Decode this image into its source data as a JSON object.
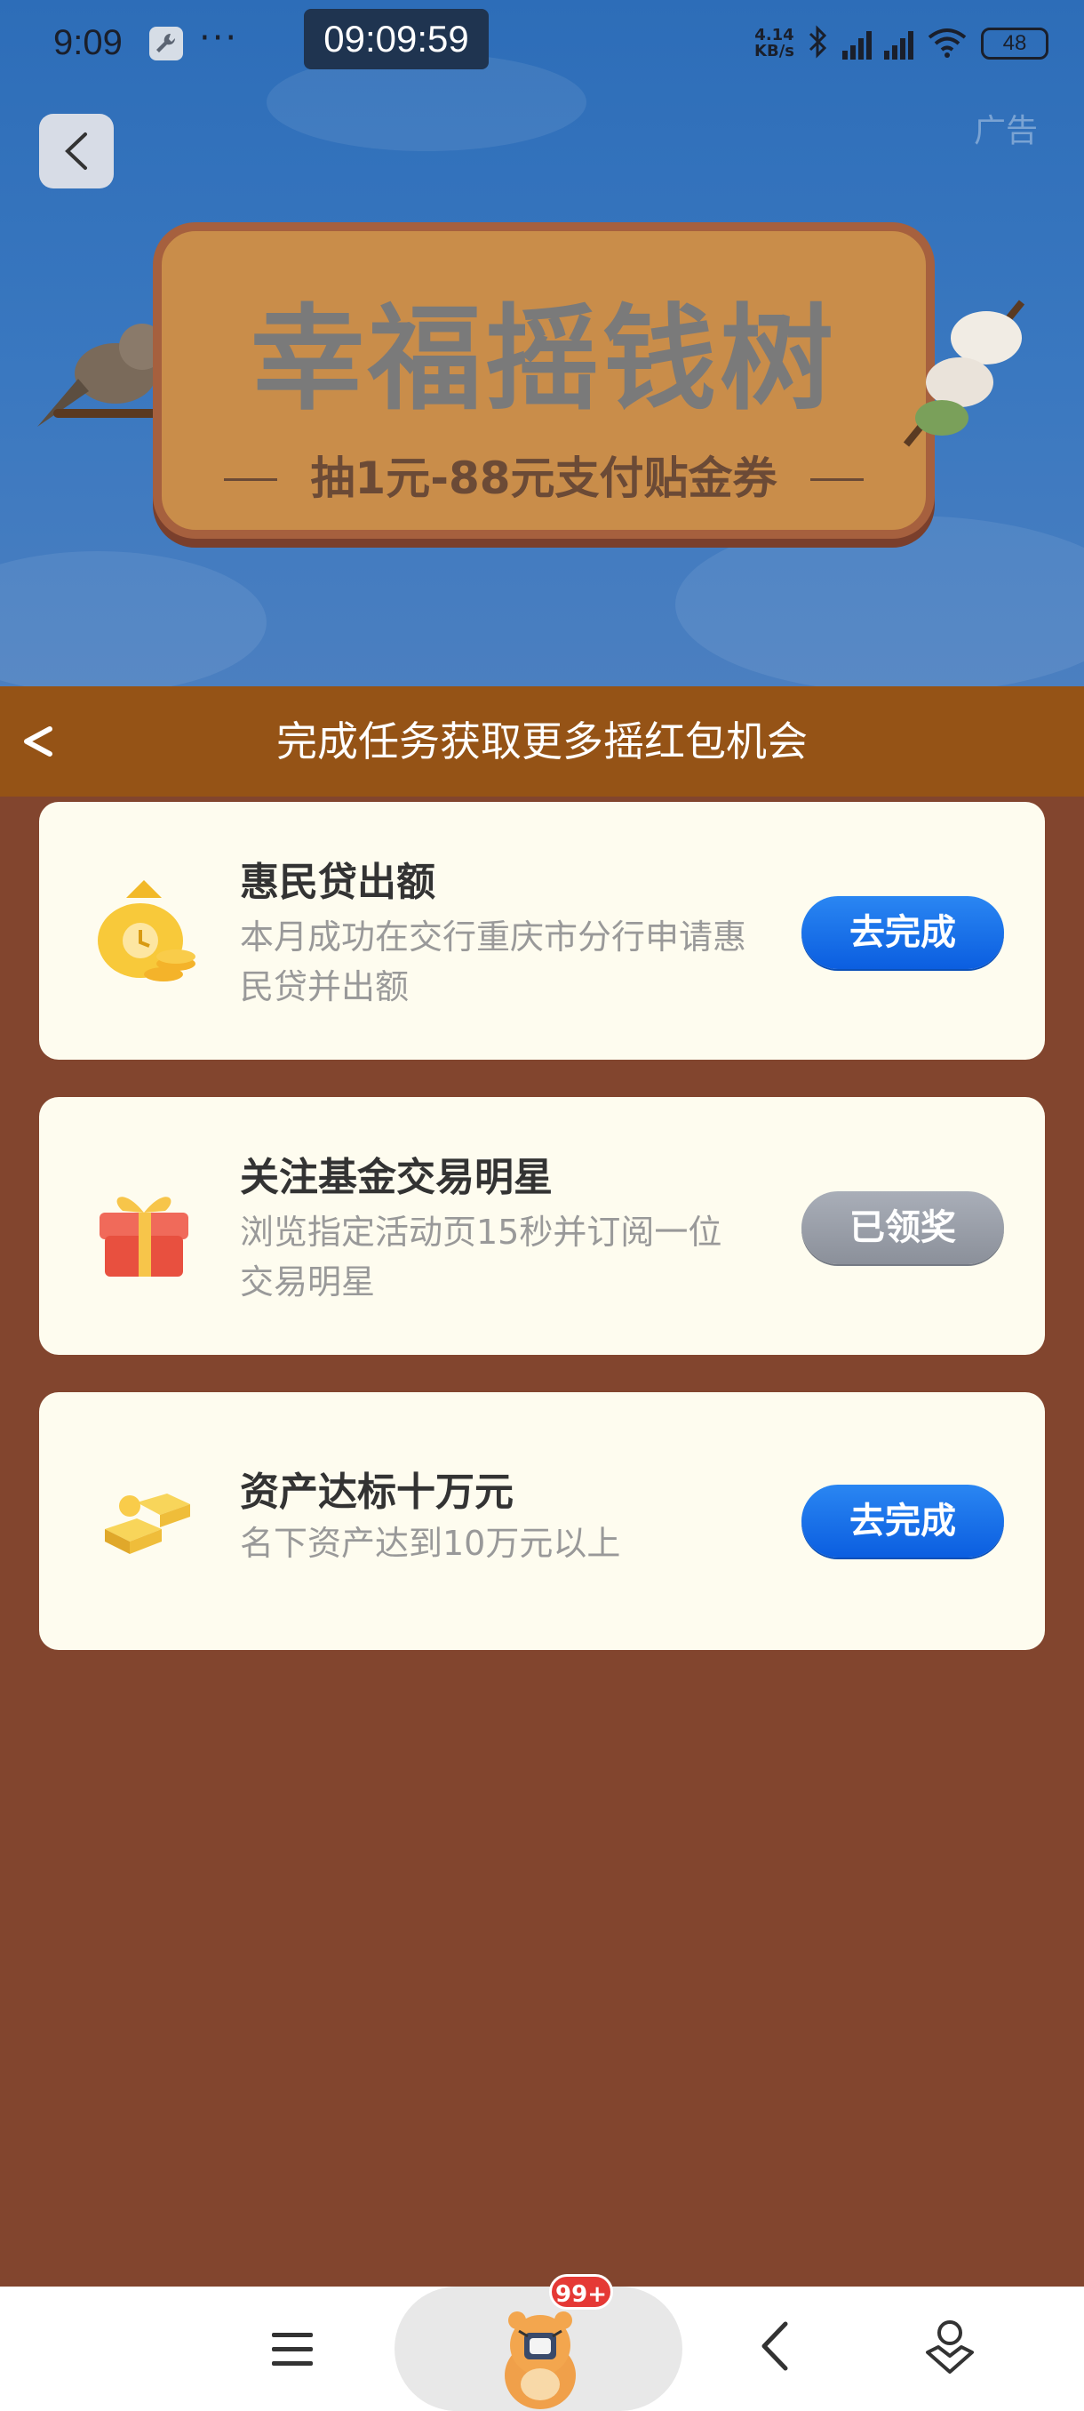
{
  "status_bar": {
    "time": "9:09",
    "dots": "···",
    "clock": "09:09:59",
    "net_speed_top": "4.14",
    "net_speed_bottom": "KB/s",
    "battery": "48"
  },
  "hero": {
    "ad_label": "广告",
    "banner_title": "幸福摇钱树",
    "banner_subtitle": "抽1元-88元支付贴金券"
  },
  "task_section": {
    "title": "完成任务获取更多摇红包机会"
  },
  "tasks": [
    {
      "title": "惠民贷出额",
      "desc": "本月成功在交行重庆市分行申请惠民贷并出额",
      "button": "去完成",
      "icon": "money-bag-icon",
      "state": "pending"
    },
    {
      "title": "关注基金交易明星",
      "desc": "浏览指定活动页15秒并订阅一位交易明星",
      "button": "已领奖",
      "icon": "gift-box-icon",
      "state": "claimed"
    },
    {
      "title": "资产达标十万元",
      "desc": "名下资产达到10万元以上",
      "button": "去完成",
      "icon": "gold-bars-icon",
      "state": "pending"
    }
  ],
  "bottom_nav": {
    "badge": "99+"
  },
  "colors": {
    "page_bg": "#82452e",
    "header_bg": "#955316",
    "card_bg": "#fefcef",
    "button_blue": "#1a6fe8",
    "button_gray": "#9a9fa9"
  }
}
